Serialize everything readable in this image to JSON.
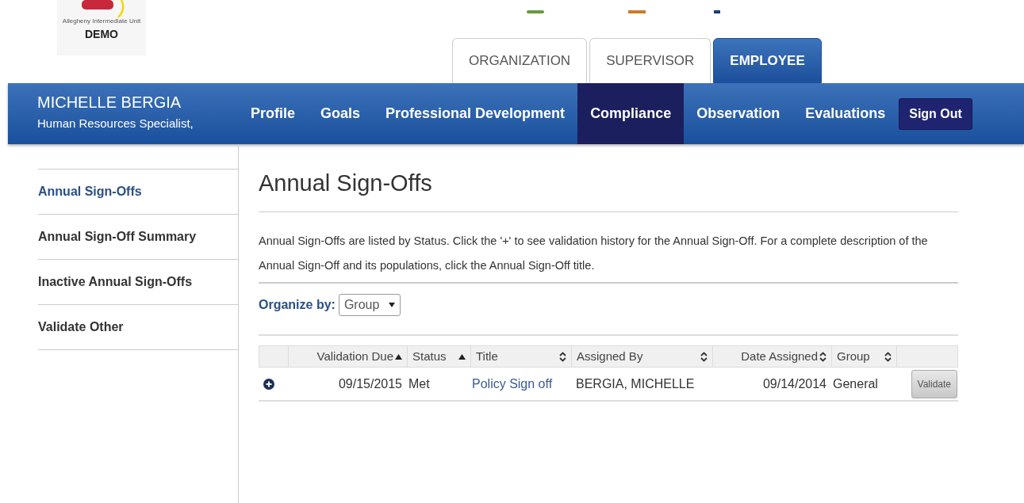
{
  "logo": {
    "tagline": "Allegheny Intermediate Unit",
    "label": "DEMO"
  },
  "tabs": [
    {
      "label": "ORGANIZATION",
      "selected": false
    },
    {
      "label": "SUPERVISOR",
      "selected": false
    },
    {
      "label": "EMPLOYEE",
      "selected": true
    }
  ],
  "user": {
    "name": "MICHELLE BERGIA",
    "role": "Human Resources Specialist,"
  },
  "nav": [
    {
      "label": "Profile",
      "selected": false
    },
    {
      "label": "Goals",
      "selected": false
    },
    {
      "label": "Professional Development",
      "selected": false
    },
    {
      "label": "Compliance",
      "selected": true
    },
    {
      "label": "Observation",
      "selected": false
    },
    {
      "label": "Evaluations",
      "selected": false
    }
  ],
  "sign_out": "Sign Out",
  "sidebar": {
    "items": [
      {
        "label": "Annual Sign-Offs",
        "selected": true
      },
      {
        "label": "Annual Sign-Off Summary",
        "selected": false
      },
      {
        "label": "Inactive Annual Sign-Offs",
        "selected": false
      },
      {
        "label": "Validate Other",
        "selected": false
      }
    ]
  },
  "page": {
    "title": "Annual Sign-Offs",
    "description": "Annual Sign-Offs are listed by Status. Click the '+' to see validation history for the Annual Sign-Off. For a complete description of the Annual Sign-Off and its populations, click the Annual Sign-Off title.",
    "organize_label": "Organize by:",
    "organize_value": "Group"
  },
  "table": {
    "columns": [
      {
        "label": "Validation Due",
        "sorted": true
      },
      {
        "label": "Status",
        "sorted": true
      },
      {
        "label": "Title",
        "sorted": false
      },
      {
        "label": "Assigned By",
        "sorted": false
      },
      {
        "label": "Date Assigned",
        "sorted": false
      },
      {
        "label": "Group",
        "sorted": false
      }
    ],
    "rows": [
      {
        "validation_due": "09/15/2015",
        "status": "Met",
        "title": "Policy Sign off",
        "assigned_by": "BERGIA, MICHELLE",
        "date_assigned": "09/14/2014",
        "group": "General",
        "action": "Validate"
      }
    ]
  }
}
